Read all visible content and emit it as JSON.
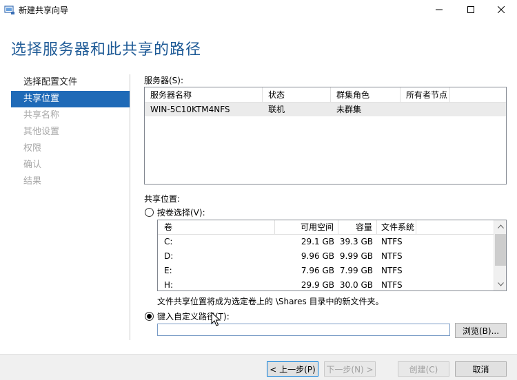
{
  "window": {
    "title": "新建共享向导"
  },
  "heading": "选择服务器和此共享的路径",
  "nav": {
    "items": [
      {
        "label": "选择配置文件"
      },
      {
        "label": "共享位置"
      },
      {
        "label": "共享名称"
      },
      {
        "label": "其他设置"
      },
      {
        "label": "权限"
      },
      {
        "label": "确认"
      },
      {
        "label": "结果"
      }
    ],
    "active_index": 1
  },
  "servers": {
    "label": "服务器(S):",
    "columns": [
      "服务器名称",
      "状态",
      "群集角色",
      "所有者节点"
    ],
    "rows": [
      {
        "name": "WIN-5C10KTM4NFS",
        "status": "联机",
        "cluster_role": "未群集",
        "owner_node": ""
      }
    ]
  },
  "share_location": {
    "label": "共享位置:",
    "by_volume_label": "按卷选择(V):",
    "by_volume_selected": false,
    "volume_columns": [
      "卷",
      "可用空间",
      "容量",
      "文件系统"
    ],
    "volumes": [
      {
        "volume": "C:",
        "free": "29.1 GB",
        "capacity": "39.3 GB",
        "fs": "NTFS"
      },
      {
        "volume": "D:",
        "free": "9.96 GB",
        "capacity": "9.99 GB",
        "fs": "NTFS"
      },
      {
        "volume": "E:",
        "free": "7.96 GB",
        "capacity": "7.99 GB",
        "fs": "NTFS"
      },
      {
        "volume": "H:",
        "free": "29.9 GB",
        "capacity": "30.0 GB",
        "fs": "NTFS"
      }
    ],
    "volume_note": "文件共享位置将成为选定卷上的 \\Shares 目录中的新文件夹。",
    "custom_path_label": "键入自定义路径(T):",
    "custom_path_selected": true,
    "custom_path_value": "",
    "browse_label": "浏览(B)..."
  },
  "footer": {
    "prev_label": "< 上一步(P)",
    "next_label": "下一步(N) >",
    "create_label": "创建(C)",
    "cancel_label": "取消"
  },
  "colors": {
    "heading": "#1e5a96",
    "nav_active_bg": "#1f6ab7",
    "nav_disabled_text": "#a8a8a8"
  }
}
